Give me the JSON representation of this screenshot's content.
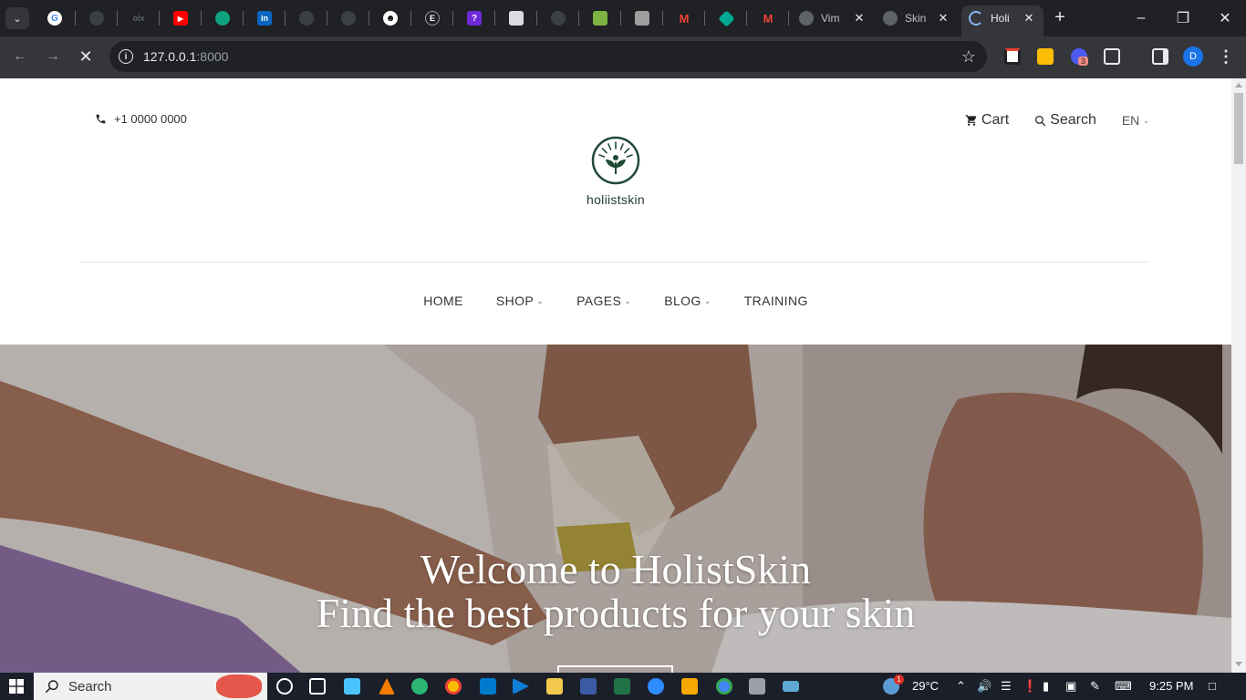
{
  "browser": {
    "tabs": [
      {
        "title": "Vim",
        "active": false
      },
      {
        "title": "Skin",
        "active": false
      },
      {
        "title": "Holi",
        "active": true
      }
    ],
    "url_host": "127.0.0.1",
    "url_port": ":8000",
    "profile_initial": "D",
    "ext_badge": "3"
  },
  "site": {
    "phone": "+1 0000 0000",
    "cart_label": "Cart",
    "search_label": "Search",
    "lang": "EN",
    "logo_name": "holiistskin",
    "nav": [
      {
        "label": "HOME",
        "dropdown": false
      },
      {
        "label": "SHOP",
        "dropdown": true
      },
      {
        "label": "PAGES",
        "dropdown": true
      },
      {
        "label": "BLOG",
        "dropdown": true
      },
      {
        "label": "TRAINING",
        "dropdown": false
      }
    ],
    "hero": {
      "line1": "Welcome to HolistSkin",
      "line2": "Find the best products for your skin"
    }
  },
  "taskbar": {
    "search_label": "Search",
    "temperature": "29°C",
    "time": "9:25 PM",
    "weather_badge": "1"
  }
}
